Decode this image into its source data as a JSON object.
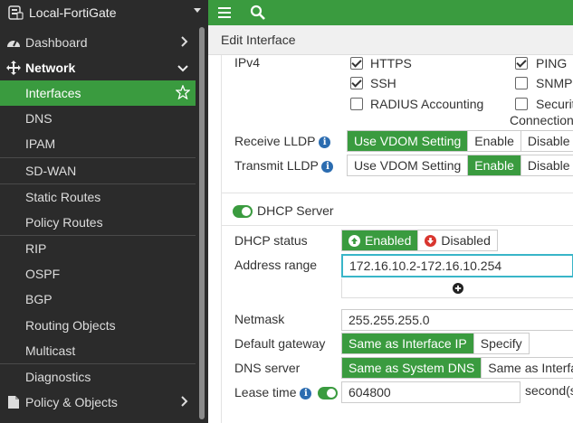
{
  "sidebar": {
    "device_name": "Local-FortiGate",
    "items": [
      {
        "label": "Dashboard"
      },
      {
        "label": "Network"
      },
      {
        "label": "Policy & Objects"
      }
    ],
    "network_sub": [
      {
        "label": "Interfaces"
      },
      {
        "label": "DNS"
      },
      {
        "label": "IPAM"
      },
      {
        "label": "SD-WAN"
      },
      {
        "label": "Static Routes"
      },
      {
        "label": "Policy Routes"
      },
      {
        "label": "RIP"
      },
      {
        "label": "OSPF"
      },
      {
        "label": "BGP"
      },
      {
        "label": "Routing Objects"
      },
      {
        "label": "Multicast"
      },
      {
        "label": "Diagnostics"
      }
    ]
  },
  "header": {
    "title": "Edit Interface"
  },
  "admin_access": {
    "section_label": "IPv4",
    "options": [
      {
        "label": "HTTPS",
        "checked": true
      },
      {
        "label": "PING",
        "checked": true
      },
      {
        "label": "SSH",
        "checked": true
      },
      {
        "label": "SNMP",
        "checked": false
      },
      {
        "label": "RADIUS Accounting",
        "checked": false
      },
      {
        "label": "Securit",
        "checked": false
      }
    ],
    "connection_label": "Connection"
  },
  "lldp": {
    "receive_label": "Receive LLDP",
    "transmit_label": "Transmit LLDP",
    "options": [
      "Use VDOM Setting",
      "Enable",
      "Disable"
    ],
    "receive_selected": "Use VDOM Setting",
    "transmit_selected": "Enable"
  },
  "dhcp": {
    "section_label": "DHCP Server",
    "status_label": "DHCP status",
    "status_options": [
      "Enabled",
      "Disabled"
    ],
    "address_range_label": "Address range",
    "address_range_value": "172.16.10.2-172.16.10.254",
    "netmask_label": "Netmask",
    "netmask_value": "255.255.255.0",
    "gateway_label": "Default gateway",
    "gateway_options": [
      "Same as Interface IP",
      "Specify"
    ],
    "dns_label": "DNS server",
    "dns_options": [
      "Same as System DNS",
      "Same as Interface"
    ],
    "lease_label": "Lease time",
    "lease_value": "604800",
    "lease_unit": "second(s"
  },
  "colors": {
    "accent": "#3a9b3f",
    "sidebar_bg": "#2b2b2b",
    "focus": "#39b5c8"
  }
}
